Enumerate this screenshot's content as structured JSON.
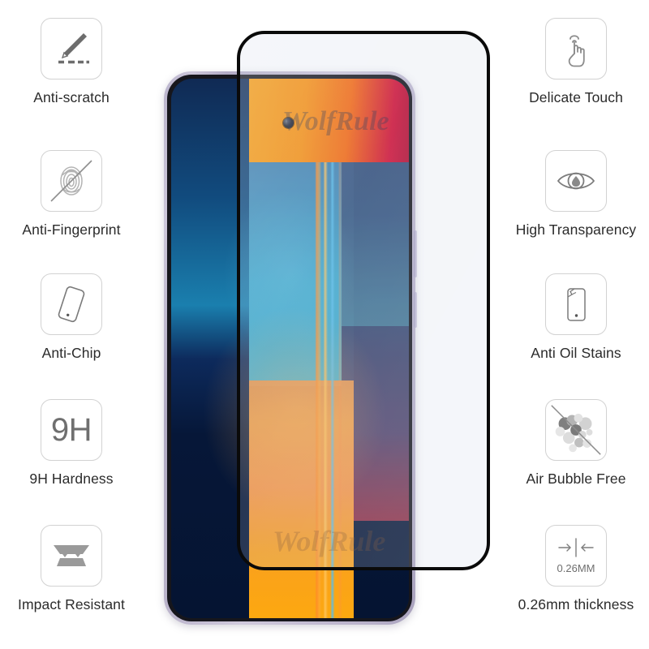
{
  "product": {
    "brand_watermark": "WolfRule",
    "phone": {
      "camera": "punch-hole-front-camera",
      "glass_overlay_label": "tempered-glass-sheet"
    }
  },
  "features_left": [
    {
      "id": "anti-scratch",
      "icon": "knife-scratch-icon",
      "label": "Anti-scratch"
    },
    {
      "id": "anti-fingerprint",
      "icon": "fingerprint-crossed-icon",
      "label": "Anti-Fingerprint"
    },
    {
      "id": "anti-chip",
      "icon": "tilted-phone-icon",
      "label": "Anti-Chip"
    },
    {
      "id": "9h-hardness",
      "icon": "hardness-9h-icon",
      "label": "9H Hardness",
      "icon_text": "9H"
    },
    {
      "id": "impact-resistant",
      "icon": "layered-plates-icon",
      "label": "Impact Resistant"
    }
  ],
  "features_right": [
    {
      "id": "delicate-touch",
      "icon": "touch-hand-icon",
      "label": "Delicate Touch"
    },
    {
      "id": "high-transparency",
      "icon": "eye-icon",
      "label": "High Transparency"
    },
    {
      "id": "anti-oil-stains",
      "icon": "cracked-phone-icon",
      "label": "Anti Oil Stains"
    },
    {
      "id": "air-bubble-free",
      "icon": "bubbles-crossed-icon",
      "label": "Air Bubble Free"
    },
    {
      "id": "thickness",
      "icon": "thickness-arrows-icon",
      "label": "0.26mm thickness",
      "icon_text": "0.26MM"
    }
  ],
  "colors": {
    "background": "#ffffff",
    "label_text": "#2b2b2b",
    "icon_stroke": "#7a7a7a",
    "icon_box_border": "#d2d2d2",
    "glass_border": "#0a0a0a",
    "phone_frame": "#c0b9d2",
    "screen_blue": "#1a7fae",
    "screen_orange": "#fb9f13",
    "screen_crimson": "#b60f34"
  }
}
